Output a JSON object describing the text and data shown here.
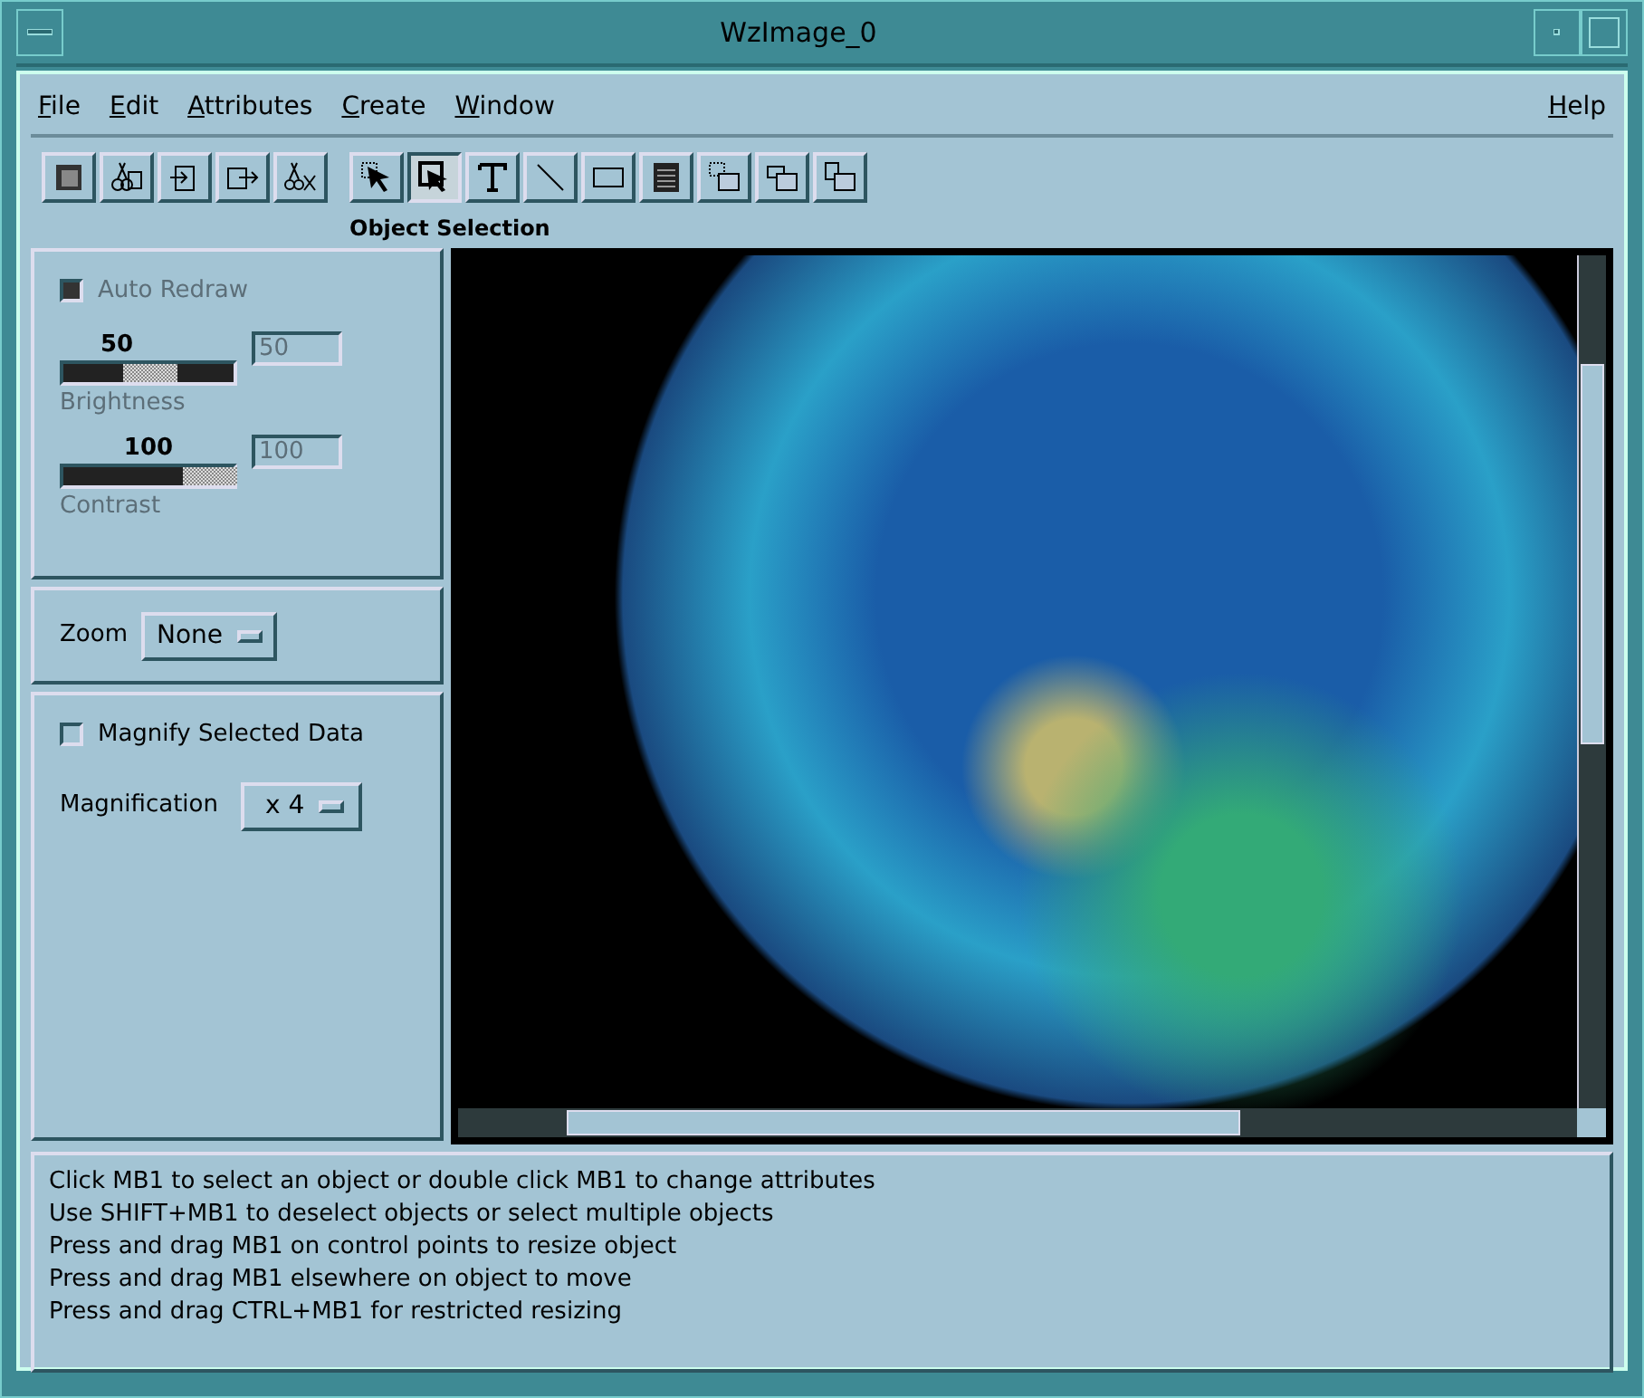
{
  "window": {
    "title": "WzImage_0"
  },
  "menu": [
    {
      "label": "File",
      "mnemonic": true
    },
    {
      "label": "Edit",
      "mnemonic": true
    },
    {
      "label": "Attributes",
      "mnemonic": true
    },
    {
      "label": "Create",
      "mnemonic": true
    },
    {
      "label": "Window",
      "mnemonic": true
    }
  ],
  "help_menu": {
    "label": "Help",
    "mnemonic": true
  },
  "toolbar": {
    "groups": [
      [
        {
          "kind": "frame",
          "selected": false
        },
        {
          "kind": "cut",
          "selected": false
        },
        {
          "kind": "import",
          "selected": false
        },
        {
          "kind": "export",
          "selected": false
        },
        {
          "kind": "delete",
          "selected": false
        }
      ],
      [
        {
          "kind": "pointer",
          "selected": false
        },
        {
          "kind": "select",
          "selected": true
        },
        {
          "kind": "text",
          "selected": false
        },
        {
          "kind": "line",
          "selected": false
        },
        {
          "kind": "rectangle",
          "selected": false
        },
        {
          "kind": "list",
          "selected": false
        },
        {
          "kind": "layer-up",
          "selected": false
        },
        {
          "kind": "layer-mid",
          "selected": false
        },
        {
          "kind": "layer-down",
          "selected": false
        }
      ]
    ],
    "label": "Object Selection"
  },
  "display_panel": {
    "auto_redraw": {
      "label": "Auto Redraw",
      "checked": true,
      "disabled": true
    },
    "sliders": [
      {
        "label": "Brightness",
        "reading": "50",
        "value": "50",
        "level": 0.5,
        "disabled": true
      },
      {
        "label": "Contrast",
        "reading": "100",
        "value": "100",
        "level": 1,
        "disabled": true
      }
    ]
  },
  "zoom": {
    "label": "Zoom",
    "value": "None"
  },
  "magnify": {
    "checkbox": {
      "label": "Magnify Selected Data",
      "checked": false
    },
    "label": "Magnification",
    "value": "x 4"
  },
  "status": [
    "Click MB1 to select an object or double click MB1 to change attributes",
    "Use SHIFT+MB1 to deselect objects or select multiple objects",
    "Press and drag MB1 on control points to resize object",
    "Press and drag MB1 elsewhere on object to move",
    "Press and drag CTRL+MB1 for restricted resizing"
  ]
}
